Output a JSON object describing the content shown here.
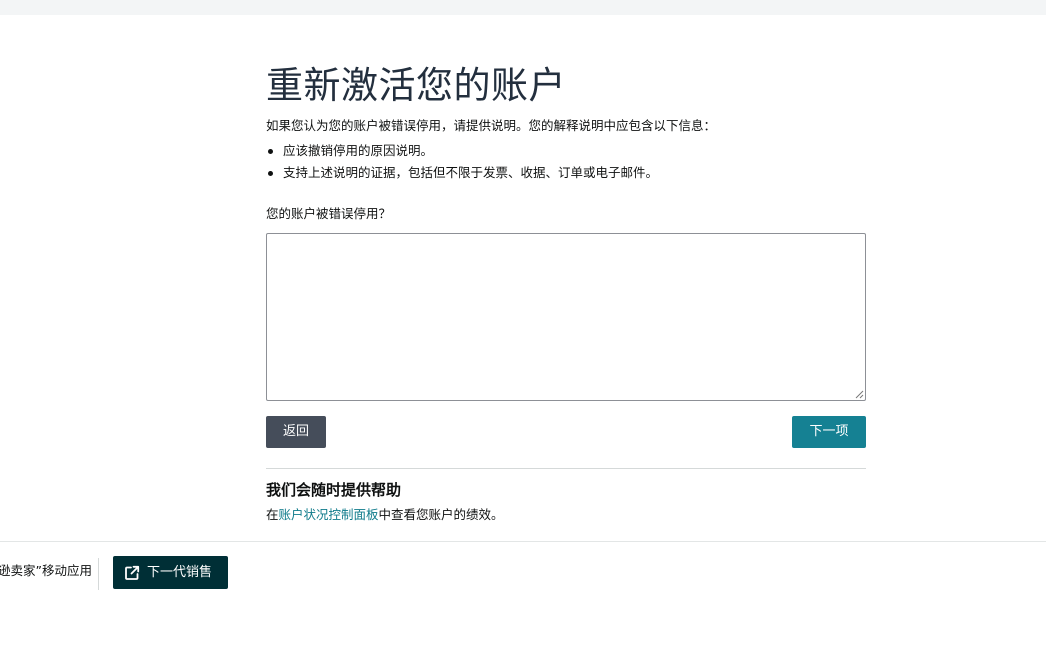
{
  "page": {
    "title": "重新激活您的账户",
    "intro": "如果您认为您的账户被错误停用，请提供说明。您的解释说明中应包含以下信息：",
    "bullets": [
      "应该撤销停用的原因说明。",
      "支持上述说明的证据，包括但不限于发票、收据、订单或电子邮件。"
    ],
    "question_label": "您的账户被错误停用？",
    "textarea_value": ""
  },
  "buttons": {
    "back_label": "返回",
    "next_label": "下一项"
  },
  "help": {
    "title": "我们会随时提供帮助",
    "text_prefix": "在",
    "link_text": "账户状况控制面板",
    "text_suffix": "中查看您账户的绩效。"
  },
  "footer": {
    "app_text": "“亚马逊卖家”移动应用",
    "nextgen_label": "下一代销售",
    "nextgen_icon": "external-link-icon"
  },
  "colors": {
    "primary_teal": "#158193",
    "back_button": "#454d5a",
    "nextgen_button": "#002f36",
    "link": "#0e7a8a"
  }
}
